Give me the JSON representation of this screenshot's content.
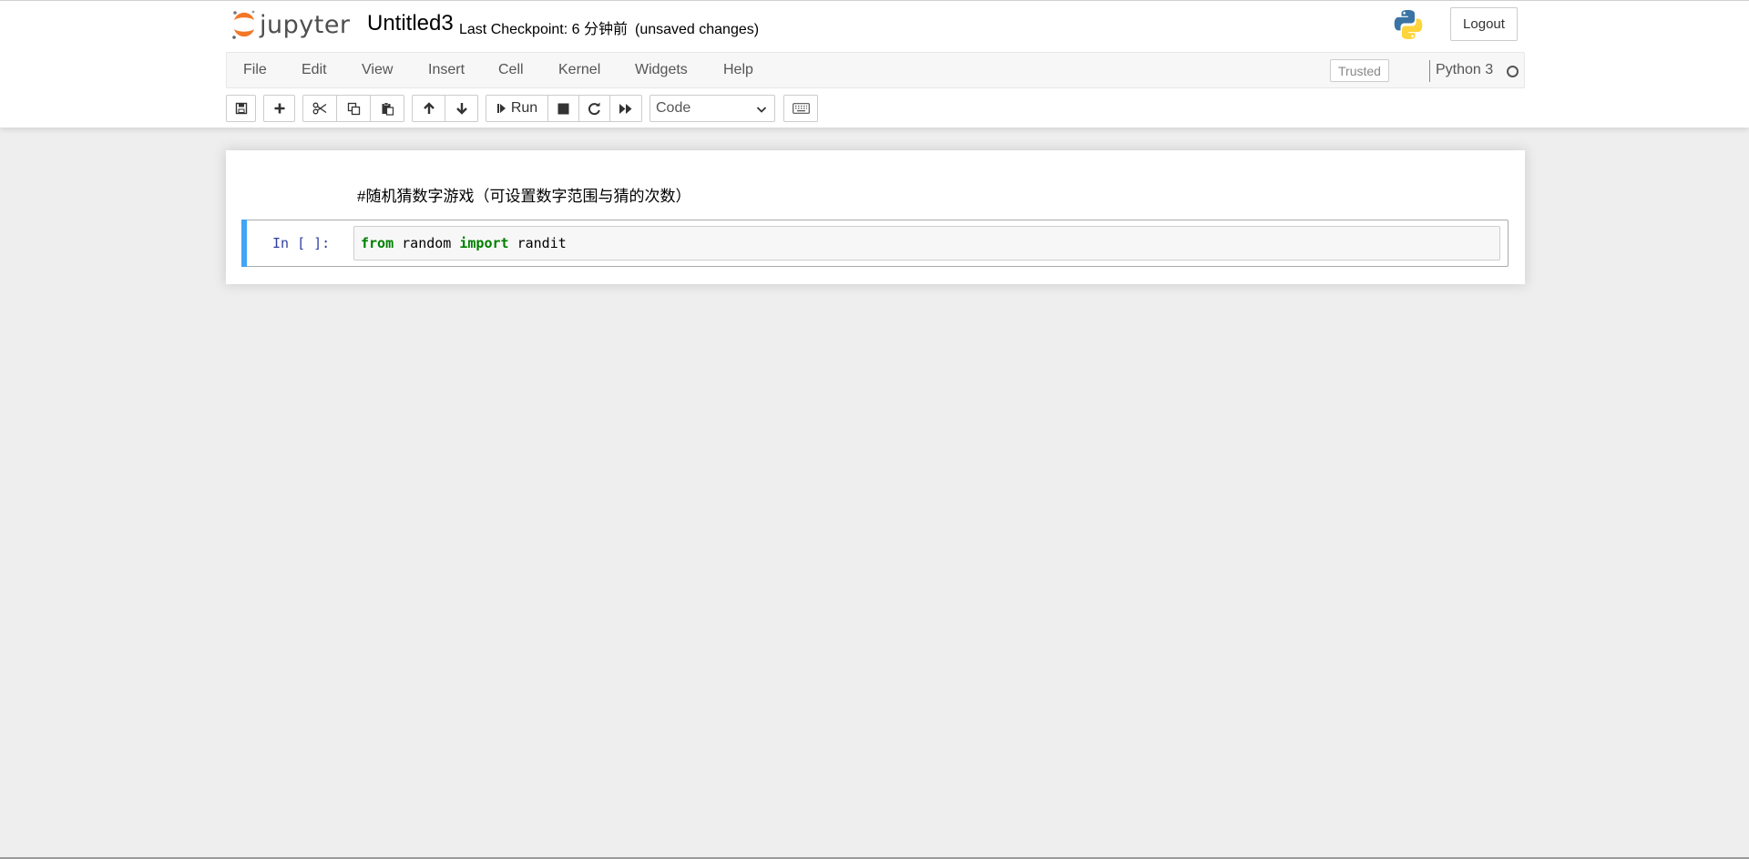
{
  "header": {
    "logo_text": "jupyter",
    "notebook_name": "Untitled3",
    "checkpoint": "Last Checkpoint: 6 分钟前",
    "autosave_status": "(unsaved changes)",
    "logout_label": "Logout",
    "kernel_logo_icon": "python-logo-icon"
  },
  "menubar": {
    "items": [
      "File",
      "Edit",
      "View",
      "Insert",
      "Cell",
      "Kernel",
      "Widgets",
      "Help"
    ],
    "trusted_label": "Trusted",
    "kernel_name": "Python 3",
    "kernel_status_icon": "kernel-idle-circle-icon"
  },
  "toolbar": {
    "icons": [
      "save-icon",
      "plus-icon",
      "cut-icon",
      "copy-icon",
      "paste-icon",
      "arrow-up-icon",
      "arrow-down-icon",
      "step-forward-icon",
      "stop-icon",
      "restart-icon",
      "fast-forward-icon",
      "keyboard-icon"
    ],
    "run_label": "Run",
    "cell_type": "Code"
  },
  "cells": [
    {
      "type": "markdown",
      "text": "#随机猜数字游戏（可设置数字范围与猜的次数）"
    },
    {
      "type": "code",
      "prompt": "In [ ]:",
      "tokens": [
        {
          "text": "from",
          "kind": "keyword"
        },
        {
          "text": " random ",
          "kind": "plain"
        },
        {
          "text": "import",
          "kind": "keyword"
        },
        {
          "text": " randit",
          "kind": "plain"
        }
      ]
    }
  ],
  "colors": {
    "accent_selected_cell": "#42a5f5",
    "prompt": "#303f9f",
    "keyword": "#008000",
    "logo_orange": "#f37726",
    "background": "#eeeeee"
  }
}
